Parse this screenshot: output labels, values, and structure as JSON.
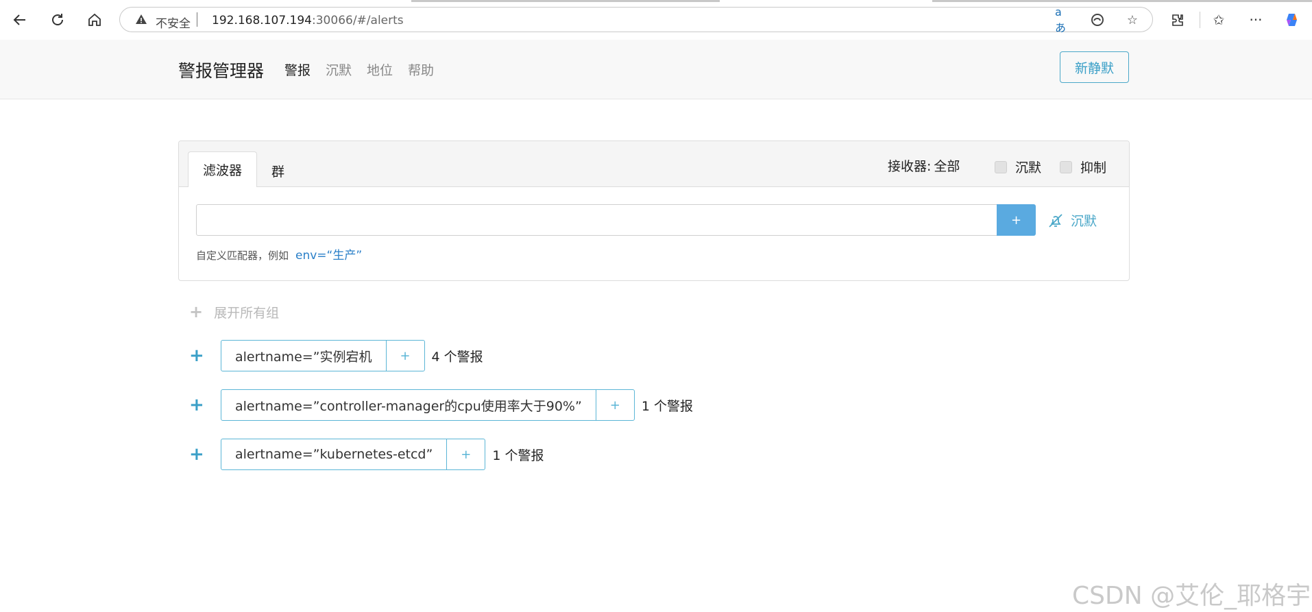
{
  "browser": {
    "insecure_label": "不安全",
    "url_host": "192.168.107.194",
    "url_rest": ":30066/#/alerts",
    "nav_icons": [
      "back-icon",
      "refresh-icon",
      "home-icon"
    ],
    "right_icons": [
      "extensions-icon",
      "favorites-icon",
      "more-icon",
      "copilot-icon"
    ]
  },
  "navbar": {
    "brand": "警报管理器",
    "links": [
      "警报",
      "沉默",
      "地位",
      "帮助"
    ],
    "active_link": "警报",
    "new_silence": "新静默"
  },
  "filter": {
    "tabs": [
      "滤波器",
      "群"
    ],
    "receiver_label": "接收器:",
    "receiver_value": "全部",
    "checkbox_silenced": "沉默",
    "checkbox_inhibited": "抑制",
    "input_value": "",
    "add_button": "+",
    "silence_link": "沉默",
    "hint": "自定义匹配器，例如",
    "hint_example": "env=“生产”"
  },
  "groups": {
    "expand_all": "展开所有组",
    "items": [
      {
        "label": "alertname=”实例宕机",
        "add": "+",
        "count": "4 个警报"
      },
      {
        "label": "alertname=”controller-manager的cpu使用率大于90%”",
        "add": "+",
        "count": "1 个警报"
      },
      {
        "label": "alertname=”kubernetes-etcd”",
        "add": "+",
        "count": "1 个警报"
      }
    ]
  },
  "watermark": "CSDN @艾伦_耶格宇",
  "colors": {
    "accent": "#3a9fc7",
    "button_blue": "#5aaae0"
  }
}
